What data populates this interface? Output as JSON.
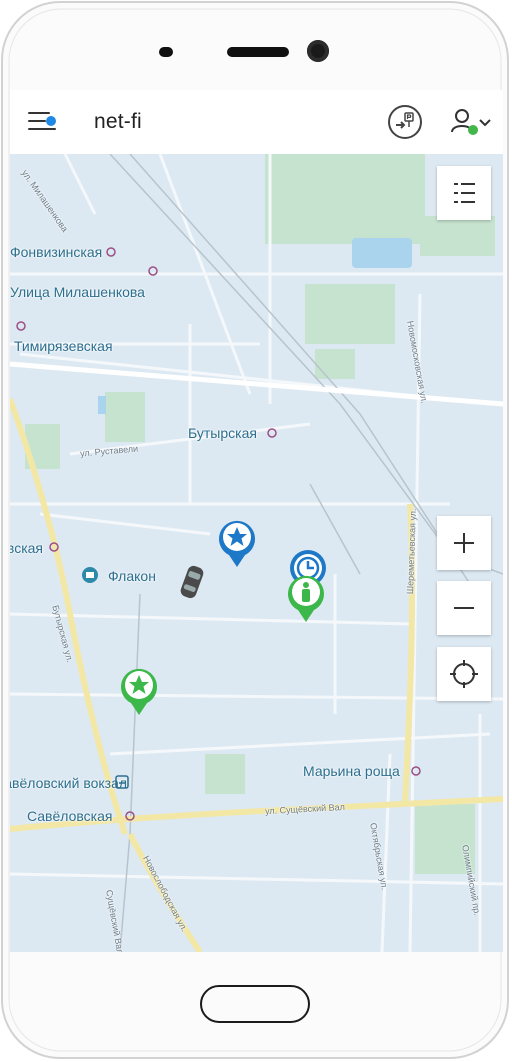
{
  "app": {
    "title": "net-fi"
  },
  "map": {
    "stations": [
      "Фонвизинская",
      "Улица Милашенкова",
      "Тимирязевская",
      "Бутырская",
      "Дмитровская",
      "Марьина роща",
      "Савёловский вокзал",
      "Савёловская"
    ],
    "places": [
      "Флакон"
    ],
    "streets": [
      "ул. Милашенкова",
      "ул. Руставели",
      "Бутырская ул.",
      "Новомосковская ул.",
      "Шереметьевская ул.",
      "ул. Сущёвский Вал",
      "Октябрьская ул.",
      "Новослободская ул.",
      "Сущёвский Вал ул.",
      "Олимпийский пр."
    ]
  },
  "controls": {
    "list_icon": "list-icon",
    "zoom_in_icon": "plus-icon",
    "zoom_out_icon": "minus-icon",
    "locate_icon": "crosshair-icon"
  },
  "markers": [
    {
      "type": "star",
      "color": "#1e78c8"
    },
    {
      "type": "clock",
      "color": "#1e78c8"
    },
    {
      "type": "person",
      "color": "#3cb84a"
    },
    {
      "type": "star",
      "color": "#3cb84a"
    },
    {
      "type": "car",
      "color": "#4a4a4a"
    }
  ],
  "colors": {
    "accent": "#1e88e5",
    "status_online": "#43b649",
    "map_water": "#aad3ee",
    "map_park": "#c6e3cf",
    "map_road_major": "#f3e7a6"
  }
}
